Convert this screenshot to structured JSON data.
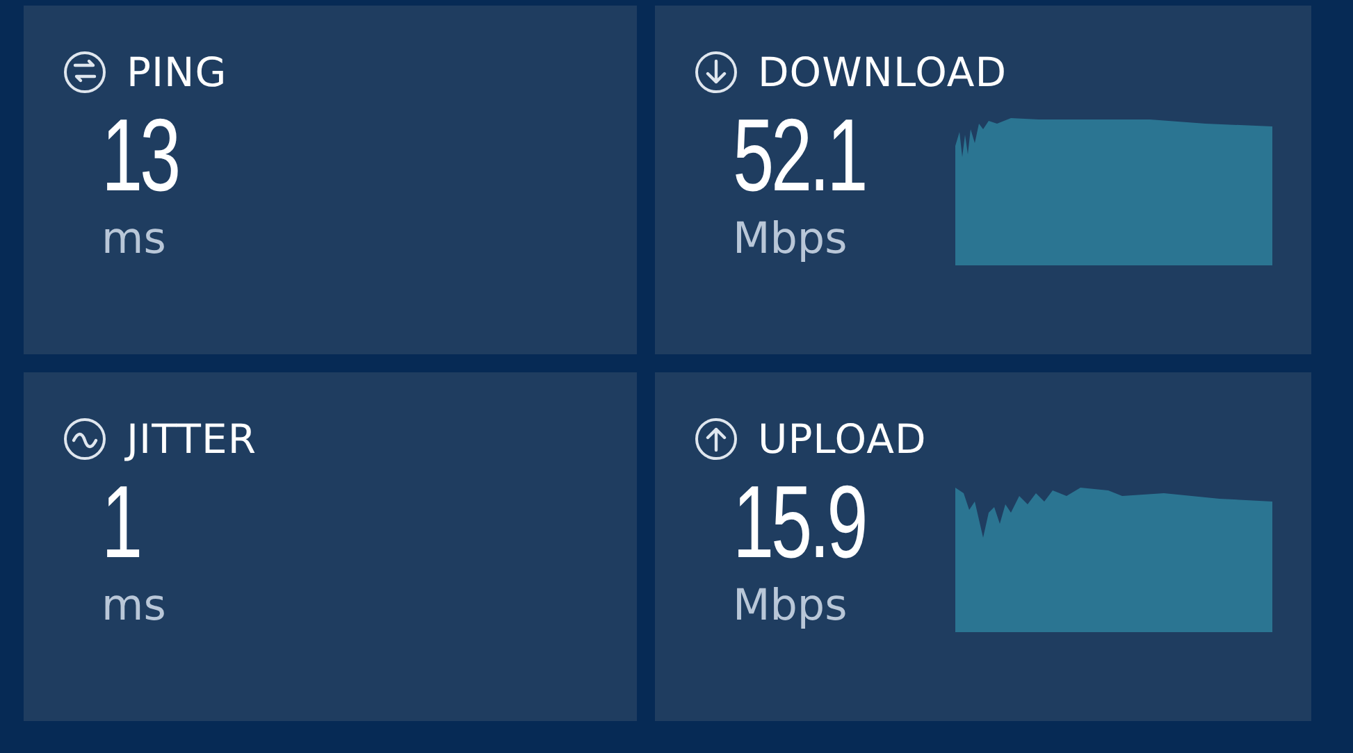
{
  "cards": [
    {
      "kind": "ping",
      "label": "PING",
      "value": "13",
      "unit": "ms"
    },
    {
      "kind": "download",
      "label": "DOWNLOAD",
      "value": "52.1",
      "unit": "Mbps"
    },
    {
      "kind": "jitter",
      "label": "JITTER",
      "value": "1",
      "unit": "ms"
    },
    {
      "kind": "upload",
      "label": "UPLOAD",
      "value": "15.9",
      "unit": "Mbps"
    }
  ]
}
